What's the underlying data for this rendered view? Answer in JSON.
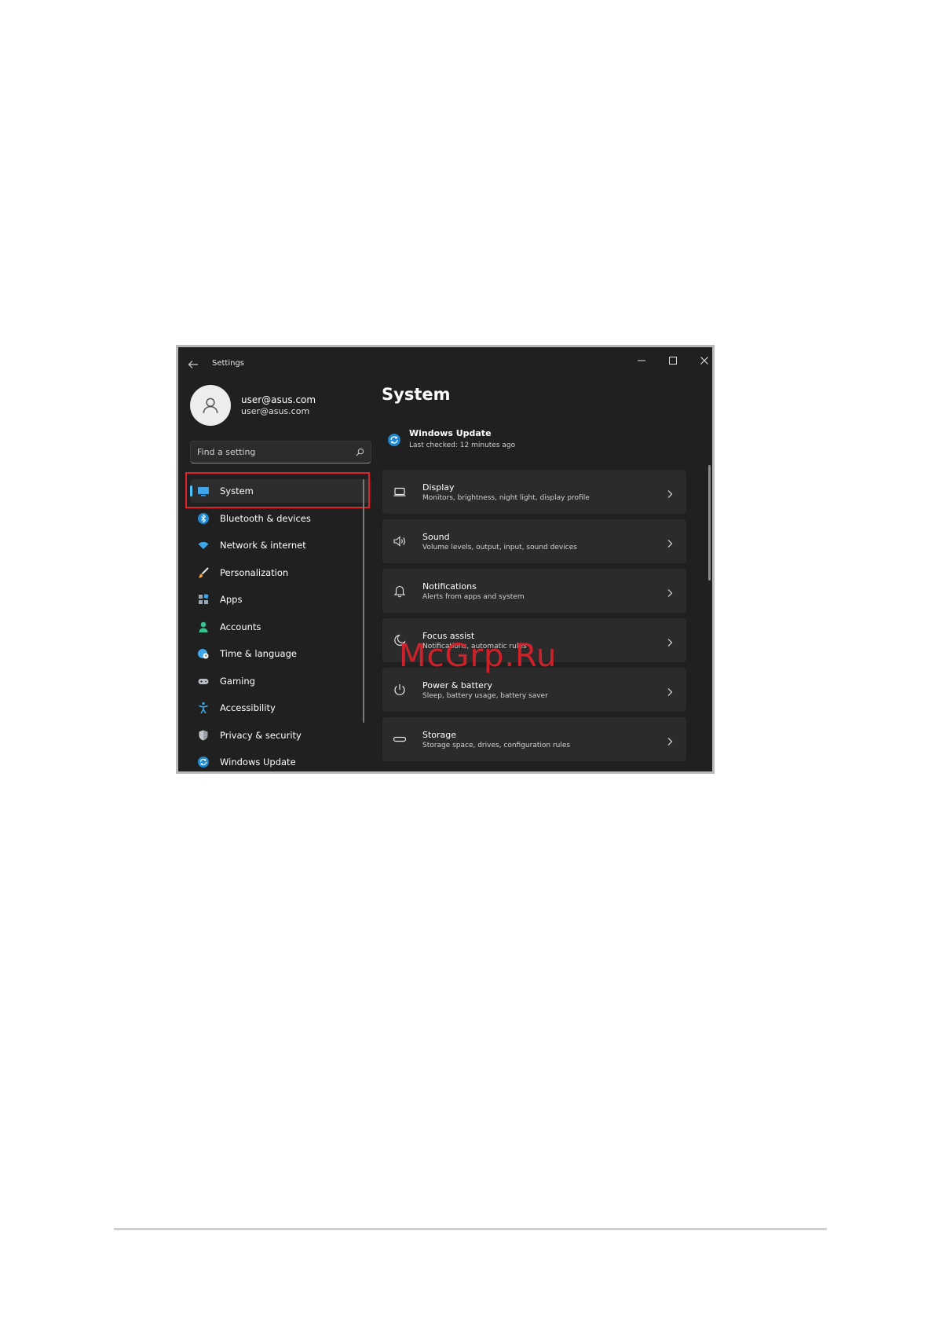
{
  "window": {
    "title": "Settings"
  },
  "user": {
    "name": "user@asus.com",
    "email": "user@asus.com"
  },
  "search": {
    "placeholder": "Find a setting"
  },
  "nav": [
    {
      "label": "System",
      "icon": "system-icon",
      "active": true
    },
    {
      "label": "Bluetooth & devices",
      "icon": "bluetooth-icon"
    },
    {
      "label": "Network & internet",
      "icon": "wifi-icon"
    },
    {
      "label": "Personalization",
      "icon": "brush-icon"
    },
    {
      "label": "Apps",
      "icon": "apps-icon"
    },
    {
      "label": "Accounts",
      "icon": "accounts-icon"
    },
    {
      "label": "Time & language",
      "icon": "time-language-icon"
    },
    {
      "label": "Gaming",
      "icon": "gaming-icon"
    },
    {
      "label": "Accessibility",
      "icon": "accessibility-icon"
    },
    {
      "label": "Privacy & security",
      "icon": "shield-icon"
    },
    {
      "label": "Windows Update",
      "icon": "update-icon"
    }
  ],
  "page": {
    "title": "System"
  },
  "windows_update": {
    "title": "Windows Update",
    "subtitle": "Last checked: 12 minutes ago"
  },
  "cards": [
    {
      "title": "Display",
      "subtitle": "Monitors, brightness, night light, display profile",
      "icon": "display-icon"
    },
    {
      "title": "Sound",
      "subtitle": "Volume levels, output, input, sound devices",
      "icon": "sound-icon"
    },
    {
      "title": "Notifications",
      "subtitle": "Alerts from apps and system",
      "icon": "bell-icon"
    },
    {
      "title": "Focus assist",
      "subtitle": "Notifications, automatic rules",
      "icon": "moon-icon"
    },
    {
      "title": "Power & battery",
      "subtitle": "Sleep, battery usage, battery saver",
      "icon": "power-icon"
    },
    {
      "title": "Storage",
      "subtitle": "Storage space, drives, configuration rules",
      "icon": "storage-icon"
    }
  ],
  "watermark": "McGrp.Ru",
  "colors": {
    "accent": "#4cc2ff",
    "highlight": "#e0202a",
    "window_bg": "#202020",
    "card_bg": "#2b2b2b"
  }
}
